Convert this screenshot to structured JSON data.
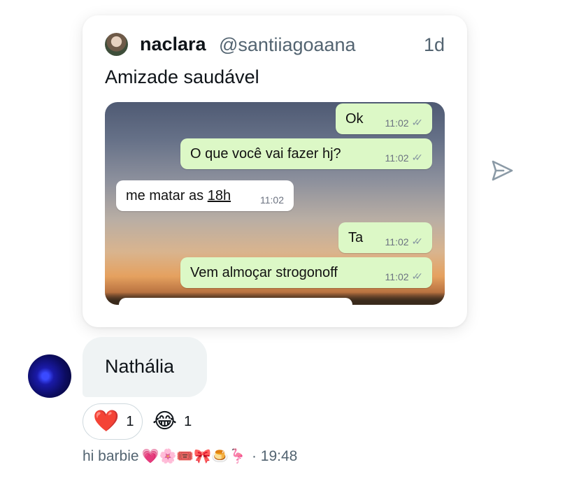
{
  "quote_card": {
    "author_name": "naclara",
    "author_handle": "@santiiagoaana",
    "age": "1d",
    "text": "Amizade saudável",
    "chat": {
      "messages": [
        {
          "text_a": "Ok",
          "time": "11:02",
          "ticks": "✓✓"
        },
        {
          "text_a": "O que você vai fazer hj?",
          "time": "11:02",
          "ticks": "✓✓"
        },
        {
          "text_a": "me matar as ",
          "text_b": "18h",
          "time": "11:02"
        },
        {
          "text_a": "Ta",
          "time": "11:02",
          "ticks": "✓✓"
        },
        {
          "text_a": "Vem almoçar strogonoff",
          "time": "11:02",
          "ticks": "✓✓"
        }
      ]
    }
  },
  "share_icon": "send-icon",
  "message": {
    "sender": "Nathália"
  },
  "reactions": [
    {
      "emoji": "❤️",
      "count": "1"
    },
    {
      "emoji": "😂",
      "count": "1"
    }
  ],
  "footer": {
    "name": "hi barbie",
    "emojis": "💗🌸🎟️🎀🍮🦩",
    "time": "· 19:48"
  },
  "colors": {
    "outgoing_bubble": "#dcf8c6",
    "incoming_bubble": "#ffffff",
    "message_bubble": "#eff3f4",
    "secondary_text": "#536471"
  }
}
